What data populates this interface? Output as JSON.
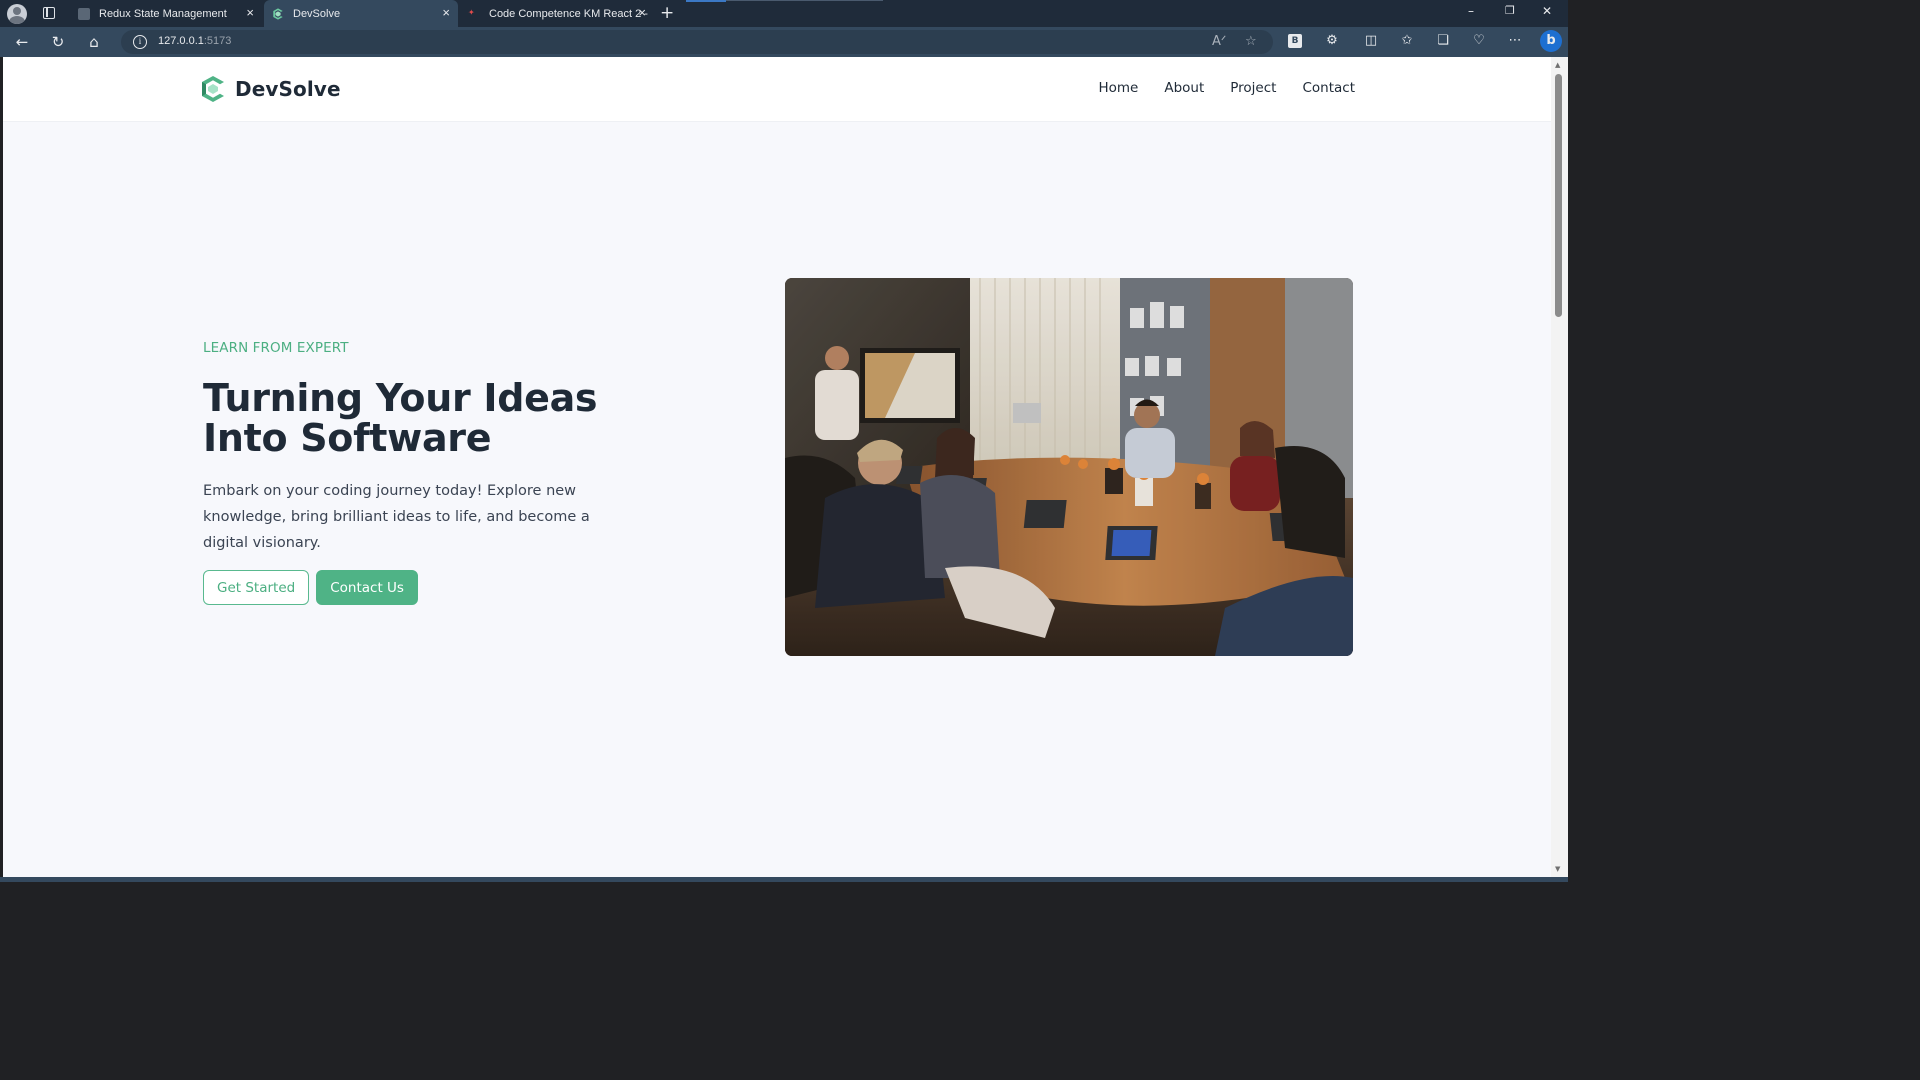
{
  "browser": {
    "tabs": [
      {
        "title": "Redux State Management",
        "close": "×"
      },
      {
        "title": "DevSolve",
        "close": "×"
      },
      {
        "title": "Code Competence KM React 2 -",
        "close": "×"
      }
    ],
    "new_tab": "+",
    "address": {
      "host": "127.0.0.1",
      "port": ":5173"
    },
    "window_controls": {
      "minimize": "–",
      "restore": "❐",
      "close": "✕"
    }
  },
  "header": {
    "brand": "DevSolve",
    "nav": [
      "Home",
      "About",
      "Project",
      "Contact"
    ]
  },
  "hero": {
    "eyebrow": "LEARN FROM EXPERT",
    "title": "Turning Your Ideas Into Software",
    "description": "Embark on your coding journey today! Explore new knowledge, bring brilliant ideas to life, and become a digital visionary.",
    "primary_button": "Get Started",
    "secondary_button": "Contact Us",
    "image_subject": "team meeting around a conference table with laptops"
  },
  "colors": {
    "accent": "#4fb386",
    "text_dark": "#1f2a37",
    "page_bg": "#f7f8fc",
    "browser_chrome": "#34495e"
  }
}
